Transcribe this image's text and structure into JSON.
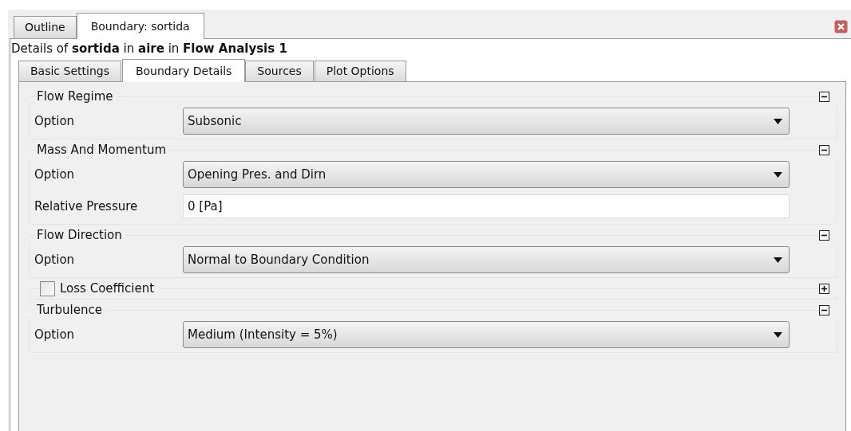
{
  "outer_tabs": [
    {
      "label": "Outline",
      "selected": false
    },
    {
      "label": "Boundary: sortida",
      "selected": true
    }
  ],
  "details": "Details of **sortida** in **aire** in **Flow Analysis 1**",
  "inner_tabs": [
    {
      "label": "Basic Settings",
      "selected": false
    },
    {
      "label": "Boundary Details",
      "selected": true
    },
    {
      "label": "Sources",
      "selected": false
    },
    {
      "label": "Plot Options",
      "selected": false
    }
  ],
  "sections": [
    {
      "kind": "plain",
      "title": "Flow Regime",
      "expanded": true,
      "rows": [
        {
          "kind": "dropdown",
          "label": "Option",
          "value": "Subsonic"
        }
      ]
    },
    {
      "kind": "plain",
      "title": "Mass And Momentum",
      "expanded": true,
      "rows": [
        {
          "kind": "dropdown",
          "label": "Option",
          "value": "Opening Pres. and Dirn"
        },
        {
          "kind": "text",
          "label": "Relative Pressure",
          "value": "0 [Pa]"
        }
      ]
    },
    {
      "kind": "plain",
      "title": "Flow Direction",
      "expanded": true,
      "rows": [
        {
          "kind": "dropdown",
          "label": "Option",
          "value": "Normal to Boundary Condition"
        }
      ]
    },
    {
      "kind": "checkbox",
      "title": "Loss Coefficient",
      "checked": false,
      "expanded": false
    },
    {
      "kind": "plain",
      "title": "Turbulence",
      "expanded": true,
      "rows": [
        {
          "kind": "dropdown",
          "label": "Option",
          "value": "Medium (Intensity = 5%)"
        }
      ]
    }
  ]
}
